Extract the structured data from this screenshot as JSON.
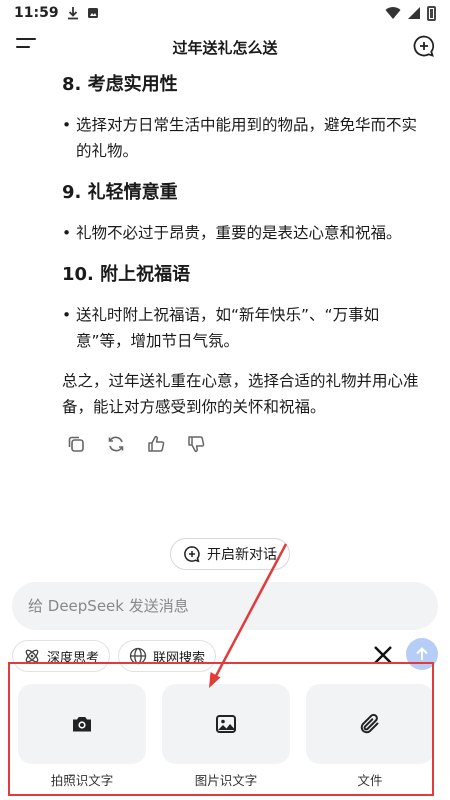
{
  "status_bar": {
    "time": "11:59"
  },
  "header": {
    "title": "过年送礼怎么送"
  },
  "content": {
    "sections": [
      {
        "heading": "8. 考虑实用性",
        "bullet": "选择对方日常生活中能用到的物品，避免华而不实的礼物。"
      },
      {
        "heading": "9. 礼轻情意重",
        "bullet": "礼物不必过于昂贵，重要的是表达心意和祝福。"
      },
      {
        "heading": "10. 附上祝福语",
        "bullet": "送礼时附上祝福语，如“新年快乐”、“万事如意”等，增加节日气氛。"
      }
    ],
    "summary": "总之，过年送礼重在心意，选择合适的礼物并用心准备，能让对方感受到你的关怀和祝福。"
  },
  "new_dialog_label": "开启新对话",
  "input": {
    "placeholder": "给 DeepSeek 发送消息"
  },
  "chips": {
    "deep_think": "深度思考",
    "web_search": "联网搜索"
  },
  "attachments": [
    {
      "label": "拍照识文字",
      "icon": "camera-icon"
    },
    {
      "label": "图片识文字",
      "icon": "image-icon"
    },
    {
      "label": "文件",
      "icon": "paperclip-icon"
    }
  ],
  "colors": {
    "annotation_red": "#e23b3b",
    "send_button": "#b5cdf7",
    "input_bg": "#f2f3f5"
  }
}
